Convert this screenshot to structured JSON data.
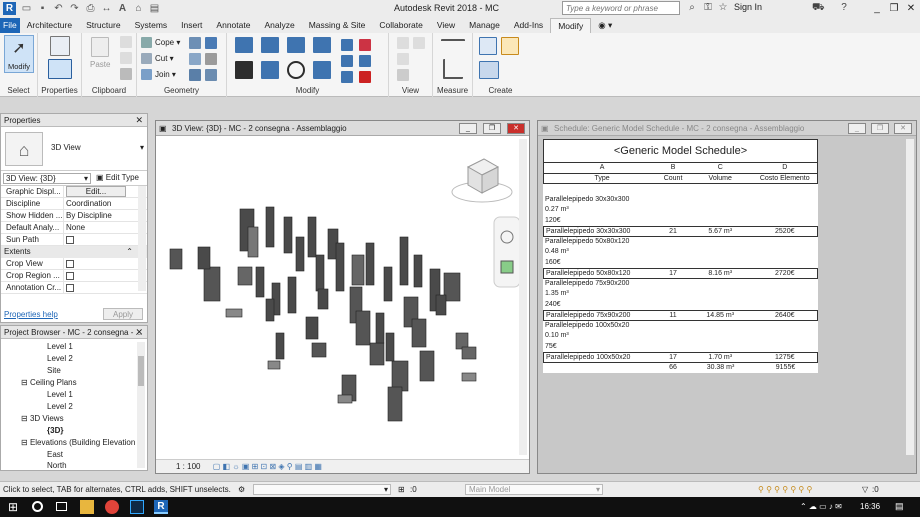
{
  "app": {
    "logo": "R",
    "title": "Autodesk Revit 2018 -    MC",
    "search_placeholder": "Type a keyword or phrase",
    "signin": "Sign In"
  },
  "ribbon": {
    "tabs": [
      "File",
      "Architecture",
      "Structure",
      "Systems",
      "Insert",
      "Annotate",
      "Analyze",
      "Massing & Site",
      "Collaborate",
      "View",
      "Manage",
      "Add-Ins",
      "Modify"
    ],
    "active_tab": "Modify",
    "groups": {
      "select": {
        "label": "Select",
        "modify": "Modify"
      },
      "properties": {
        "label": "Properties"
      },
      "clipboard": {
        "label": "Clipboard",
        "paste": "Paste"
      },
      "geometry": {
        "label": "Geometry",
        "cope": "Cope",
        "cut": "Cut",
        "join": "Join"
      },
      "modify": {
        "label": "Modify"
      },
      "view": {
        "label": "View"
      },
      "measure": {
        "label": "Measure"
      },
      "create": {
        "label": "Create"
      }
    }
  },
  "properties_panel": {
    "title": "Properties",
    "type_name": "3D View",
    "instance_selector": "3D View: {3D}",
    "edit_type": "Edit Type",
    "rows": [
      {
        "k": "Graphic Displ...",
        "v": "Edit..."
      },
      {
        "k": "Discipline",
        "v": "Coordination"
      },
      {
        "k": "Show Hidden ...",
        "v": "By Discipline"
      },
      {
        "k": "Default Analy...",
        "v": "None"
      },
      {
        "k": "Sun Path",
        "v": ""
      }
    ],
    "extents_header": "Extents",
    "extents_rows": [
      {
        "k": "Crop View",
        "v": ""
      },
      {
        "k": "Crop Region ...",
        "v": ""
      },
      {
        "k": "Annotation Cr...",
        "v": ""
      }
    ],
    "help_link": "Properties help",
    "apply": "Apply"
  },
  "project_browser": {
    "title": "Project Browser - MC - 2 consegna - ...",
    "items": [
      {
        "label": "Level 1",
        "level": 3
      },
      {
        "label": "Level 2",
        "level": 3
      },
      {
        "label": "Site",
        "level": 3
      },
      {
        "label": "Ceiling Plans",
        "level": 2
      },
      {
        "label": "Level 1",
        "level": 3
      },
      {
        "label": "Level 2",
        "level": 3
      },
      {
        "label": "3D Views",
        "level": 2
      },
      {
        "label": "{3D}",
        "level": 3
      },
      {
        "label": "Elevations (Building Elevation",
        "level": 2
      },
      {
        "label": "East",
        "level": 3
      },
      {
        "label": "North",
        "level": 3
      }
    ]
  },
  "view3d": {
    "title": "3D View: {3D} - MC - 2 consegna - Assemblaggio",
    "scale": "1 : 100"
  },
  "schedule": {
    "window_title": "Schedule: Generic Model Schedule - MC - 2 consegna - Assemblaggio",
    "heading": "<Generic Model Schedule>",
    "col_letters": [
      "A",
      "B",
      "C",
      "D"
    ],
    "col_names": [
      "Type",
      "Count",
      "Volume",
      "Costo Elemento"
    ],
    "rows": [
      {
        "c1": "",
        "c2": "",
        "c3": "",
        "c4": "",
        "boxed": false
      },
      {
        "c1": "Parallelepipedo 30x30x300",
        "c2": "",
        "c3": "",
        "c4": "",
        "boxed": false
      },
      {
        "c1": "0.27 m³",
        "c2": "",
        "c3": "",
        "c4": "",
        "boxed": false
      },
      {
        "c1": "120€",
        "c2": "",
        "c3": "",
        "c4": "",
        "boxed": false
      },
      {
        "c1": "Parallelepipedo 30x30x300",
        "c2": "21",
        "c3": "5.67 m³",
        "c4": "2520€",
        "boxed": true
      },
      {
        "c1": "Parallelepipedo 50x80x120",
        "c2": "",
        "c3": "",
        "c4": "",
        "boxed": false
      },
      {
        "c1": "0.48 m³",
        "c2": "",
        "c3": "",
        "c4": "",
        "boxed": false
      },
      {
        "c1": "160€",
        "c2": "",
        "c3": "",
        "c4": "",
        "boxed": false
      },
      {
        "c1": "Parallelepipedo 50x80x120",
        "c2": "17",
        "c3": "8.16 m³",
        "c4": "2720€",
        "boxed": true
      },
      {
        "c1": "Parallelepipedo 75x90x200",
        "c2": "",
        "c3": "",
        "c4": "",
        "boxed": false
      },
      {
        "c1": "1.35 m³",
        "c2": "",
        "c3": "",
        "c4": "",
        "boxed": false
      },
      {
        "c1": "240€",
        "c2": "",
        "c3": "",
        "c4": "",
        "boxed": false
      },
      {
        "c1": "Parallelepipedo 75x90x200",
        "c2": "11",
        "c3": "14.85 m³",
        "c4": "2640€",
        "boxed": true
      },
      {
        "c1": "Parallelepipedo 100x50x20",
        "c2": "",
        "c3": "",
        "c4": "",
        "boxed": false
      },
      {
        "c1": "0.10 m³",
        "c2": "",
        "c3": "",
        "c4": "",
        "boxed": false
      },
      {
        "c1": "75€",
        "c2": "",
        "c3": "",
        "c4": "",
        "boxed": false
      },
      {
        "c1": "Parallelepipedo 100x50x20",
        "c2": "17",
        "c3": "1.70 m³",
        "c4": "1275€",
        "boxed": true
      },
      {
        "c1": "",
        "c2": "66",
        "c3": "30.38 m³",
        "c4": "9155€",
        "boxed": false
      }
    ]
  },
  "statusbar": {
    "text": "Click to select, TAB for alternates, CTRL adds, SHIFT unselects.",
    "filter_count": ":0",
    "model": "Main Model",
    "select_count": ":0"
  },
  "taskbar": {
    "time": "16:36",
    "revit_icon": "R"
  },
  "colors": {
    "accent": "#1e66b7",
    "taskbar": "#101010"
  }
}
